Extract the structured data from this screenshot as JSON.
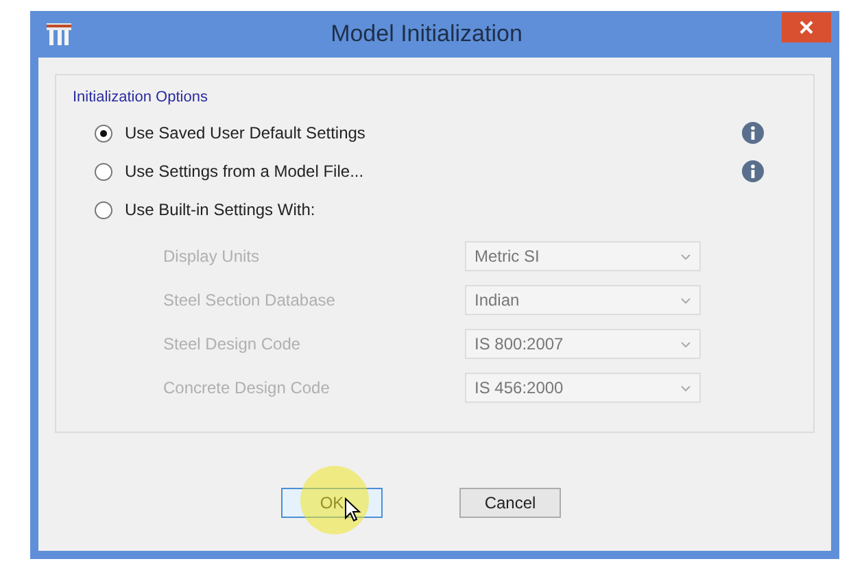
{
  "window": {
    "title": "Model Initialization"
  },
  "group": {
    "label": "Initialization Options"
  },
  "options": [
    {
      "label": "Use Saved User Default Settings",
      "selected": true,
      "info": true
    },
    {
      "label": "Use Settings from a Model File...",
      "selected": false,
      "info": true
    },
    {
      "label": "Use Built-in Settings With:",
      "selected": false,
      "info": false
    }
  ],
  "settings": [
    {
      "label": "Display Units",
      "value": "Metric SI",
      "disabled": true
    },
    {
      "label": "Steel Section Database",
      "value": "Indian",
      "disabled": true
    },
    {
      "label": "Steel Design Code",
      "value": "IS 800:2007",
      "disabled": true
    },
    {
      "label": "Concrete Design Code",
      "value": "IS 456:2000",
      "disabled": true
    }
  ],
  "buttons": [
    {
      "label": "OK",
      "default": true
    },
    {
      "label": "Cancel",
      "default": false
    }
  ],
  "pointer": {
    "highlight": true
  }
}
